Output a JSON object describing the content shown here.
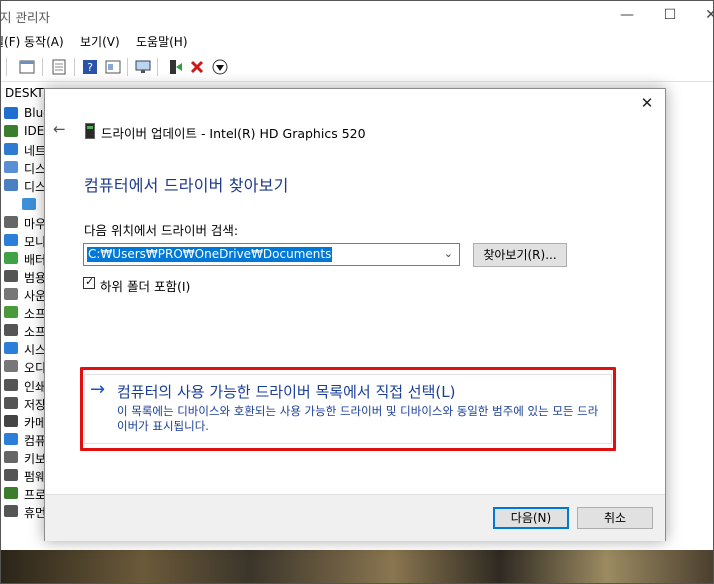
{
  "device_manager": {
    "title": "지 관리자",
    "menu": [
      "일(F)",
      "동작(A)",
      "보기(V)",
      "도움말(H)"
    ],
    "tree_root": "DESKTO",
    "tree_items": [
      {
        "label": "Blue",
        "icon_color": "#1f6fd1",
        "icon": "bluetooth-icon"
      },
      {
        "label": "IDE",
        "icon_color": "#3a7d2c",
        "icon": "ide-controller-icon"
      },
      {
        "label": "네트",
        "icon_color": "#2f7bd4",
        "icon": "network-adapter-icon"
      },
      {
        "label": "디스",
        "icon_color": "#5a8fd6",
        "icon": "disk-drive-icon"
      },
      {
        "label": "디스",
        "icon_color": "#4a7fc2",
        "icon": "display-adapter-icon"
      },
      {
        "label": "",
        "icon_color": "#3d8fd8",
        "icon": "monitor-icon"
      },
      {
        "label": "마우",
        "icon_color": "#666666",
        "icon": "mouse-icon"
      },
      {
        "label": "모니",
        "icon_color": "#2b7fd9",
        "icon": "monitor-icon"
      },
      {
        "label": "배터",
        "icon_color": "#3fa245",
        "icon": "battery-icon"
      },
      {
        "label": "범용",
        "icon_color": "#555555",
        "icon": "usb-icon"
      },
      {
        "label": "사운",
        "icon_color": "#777777",
        "icon": "audio-icon"
      },
      {
        "label": "소프",
        "icon_color": "#4a9a3c",
        "icon": "software-component-icon"
      },
      {
        "label": "소프",
        "icon_color": "#555555",
        "icon": "software-device-icon"
      },
      {
        "label": "시스",
        "icon_color": "#2b7fd9",
        "icon": "system-device-icon"
      },
      {
        "label": "오디",
        "icon_color": "#777777",
        "icon": "speaker-icon"
      },
      {
        "label": "인쇄",
        "icon_color": "#555555",
        "icon": "printer-icon"
      },
      {
        "label": "저장",
        "icon_color": "#555555",
        "icon": "storage-icon"
      },
      {
        "label": "카메",
        "icon_color": "#444444",
        "icon": "camera-icon"
      },
      {
        "label": "컴퓨",
        "icon_color": "#2b7fd9",
        "icon": "computer-icon"
      },
      {
        "label": "키보",
        "icon_color": "#666666",
        "icon": "keyboard-icon"
      },
      {
        "label": "펌웨",
        "icon_color": "#555555",
        "icon": "firmware-icon"
      },
      {
        "label": "프로",
        "icon_color": "#3a7d2c",
        "icon": "processor-icon"
      },
      {
        "label": "휴먼",
        "icon_color": "#555555",
        "icon": "hid-icon"
      }
    ]
  },
  "dialog": {
    "header": "드라이버 업데이트 - Intel(R) HD Graphics 520",
    "heading": "컴퓨터에서 드라이버 찾아보기",
    "location_label": "다음 위치에서 드라이버 검색:",
    "path_value": "C:₩Users₩PRO₩OneDrive₩Documents",
    "browse_label": "찾아보기(R)...",
    "subfolder_label": "하위 폴더 포함(I)",
    "subfolder_checked": true,
    "pick_title": "컴퓨터의 사용 가능한 드라이버 목록에서 직접 선택(L)",
    "pick_desc": "이 목록에는 디바이스와 호환되는 사용 가능한 드라이버 및 디바이스와 동일한 범주에 있는 모든 드라이버가 표시됩니다.",
    "next_label": "다음(N)",
    "cancel_label": "취소"
  },
  "colors": {
    "accent": "#0078d7",
    "link": "#1a3e99",
    "highlight": "#e01010"
  }
}
